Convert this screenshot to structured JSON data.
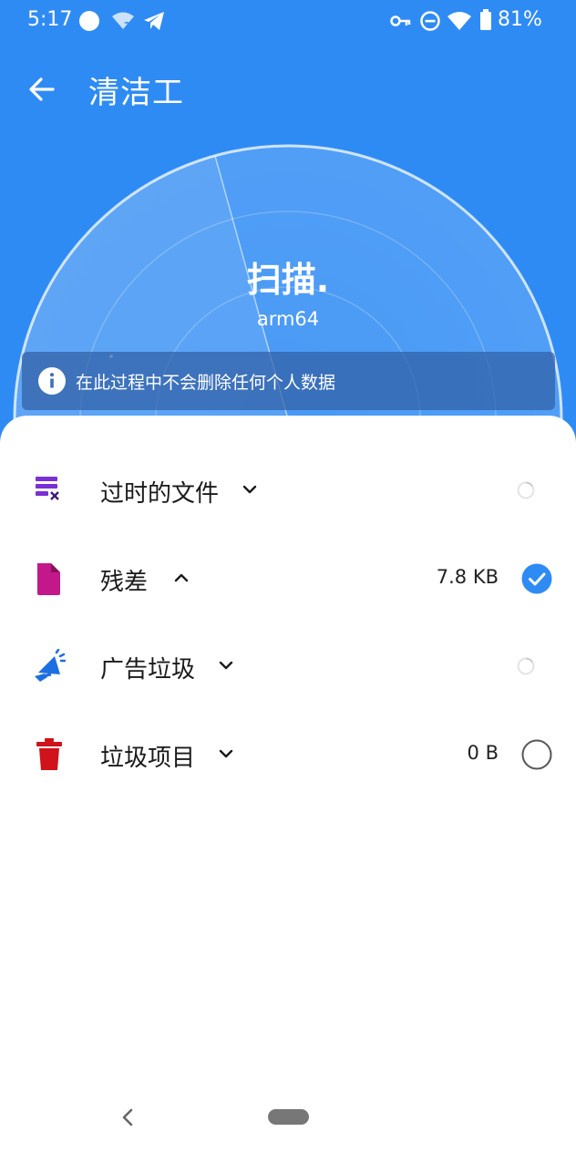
{
  "status_bar": {
    "time": "5:17",
    "battery": "81%"
  },
  "app_bar": {
    "title": "清洁工"
  },
  "scan": {
    "title": "扫描.",
    "subtitle": "arm64",
    "info": "在此过程中不会删除任何个人数据"
  },
  "categories": [
    {
      "label": "过时的文件",
      "expanded": false,
      "size": "",
      "status": "loading",
      "icon": "obsolete-files-icon",
      "color": "#7b2fd6"
    },
    {
      "label": "残差",
      "expanded": true,
      "size": "7.8 KB",
      "status": "checked",
      "icon": "residual-file-icon",
      "color": "#c2188a"
    },
    {
      "label": "广告垃圾",
      "expanded": false,
      "size": "",
      "status": "loading",
      "icon": "megaphone-icon",
      "color": "#1c6fe0"
    },
    {
      "label": "垃圾项目",
      "expanded": false,
      "size": "0 B",
      "status": "unchecked",
      "icon": "trash-icon",
      "color": "#d0121a"
    }
  ],
  "colors": {
    "primary": "#2f8bf4",
    "check": "#2f8bf4"
  }
}
